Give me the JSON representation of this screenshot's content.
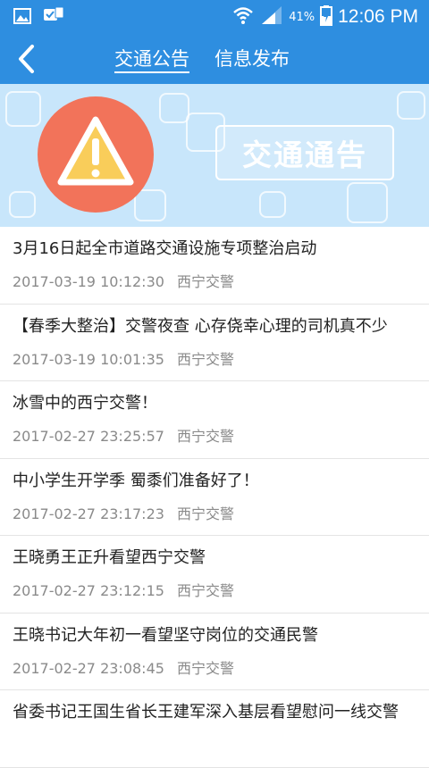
{
  "status_bar": {
    "battery": "41%",
    "time": "12:06 PM",
    "icons": [
      "gallery-icon",
      "check-notify-icon",
      "wifi-icon",
      "signal-icon",
      "battery-icon"
    ]
  },
  "header": {
    "tabs": [
      {
        "label": "交通公告",
        "active": true
      },
      {
        "label": "信息发布",
        "active": false
      }
    ]
  },
  "banner": {
    "notice_text": "交通通告"
  },
  "news": [
    {
      "title": "3月16日起全市道路交通设施专项整治启动",
      "time": "2017-03-19 10:12:30",
      "source": "西宁交警"
    },
    {
      "title": "【春季大整治】交警夜查 心存侥幸心理的司机真不少",
      "time": "2017-03-19 10:01:35",
      "source": "西宁交警"
    },
    {
      "title": "冰雪中的西宁交警！",
      "time": "2017-02-27 23:25:57",
      "source": "西宁交警"
    },
    {
      "title": "中小学生开学季 蜀黍们准备好了！",
      "time": "2017-02-27 23:17:23",
      "source": "西宁交警"
    },
    {
      "title": "王晓勇王正升看望西宁交警",
      "time": "2017-02-27 23:12:15",
      "source": "西宁交警"
    },
    {
      "title": "王晓书记大年初一看望坚守岗位的交通民警",
      "time": "2017-02-27 23:08:45",
      "source": "西宁交警"
    },
    {
      "title": "省委书记王国生省长王建军深入基层看望慰问一线交警",
      "time": "",
      "source": ""
    }
  ],
  "colors": {
    "primary": "#2e8ee0",
    "banner_bg": "#c8e6fb",
    "warning_circle": "#f2735a",
    "warning_triangle": "#f9cd5a"
  }
}
